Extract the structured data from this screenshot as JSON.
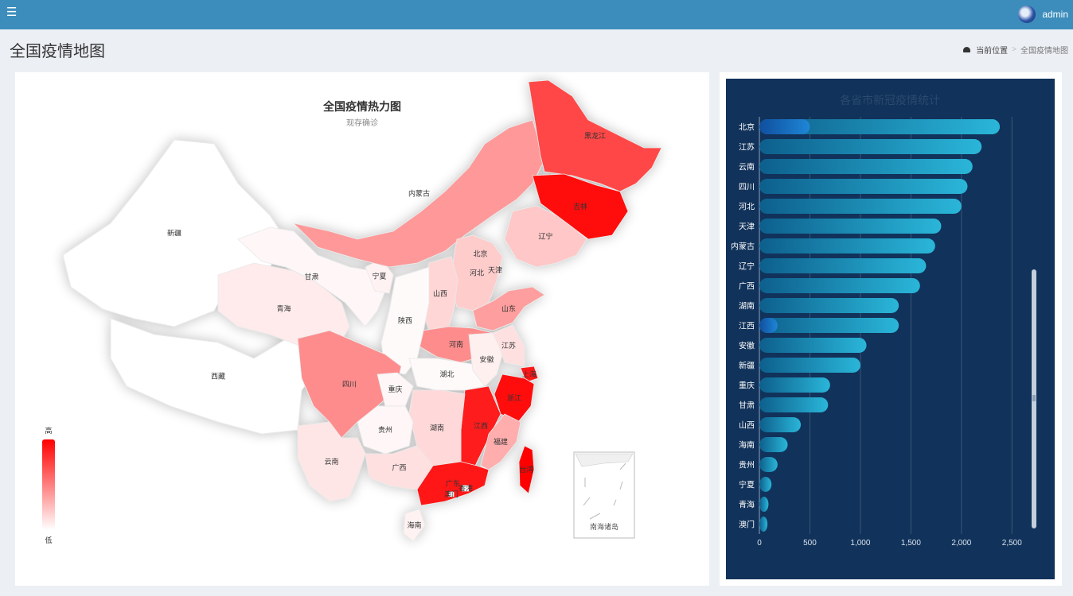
{
  "header": {
    "menu_icon": "hamburger-icon",
    "user_name": "admin",
    "avatar_icon": "avatar-icon"
  },
  "page": {
    "title": "全国疫情地图",
    "breadcrumb": {
      "icon": "dashboard-icon",
      "home": "当前位置",
      "separator": ">",
      "current": "全国疫情地图"
    }
  },
  "map": {
    "title": "全国疫情热力图",
    "subtitle": "现存确诊",
    "legend_high": "高",
    "legend_low": "低",
    "inset_label": "南海诸岛",
    "colors": {
      "high": "#ff0000",
      "low": "#ffffff"
    },
    "regions": [
      {
        "name": "新疆",
        "level": 0.0
      },
      {
        "name": "西藏",
        "level": 0.0
      },
      {
        "name": "青海",
        "level": 0.08
      },
      {
        "name": "甘肃",
        "level": 0.03
      },
      {
        "name": "宁夏",
        "level": 0.05
      },
      {
        "name": "内蒙古",
        "level": 0.4
      },
      {
        "name": "黑龙江",
        "level": 0.72
      },
      {
        "name": "吉林",
        "level": 0.95
      },
      {
        "name": "辽宁",
        "level": 0.22
      },
      {
        "name": "北京",
        "level": 0.98
      },
      {
        "name": "天津",
        "level": 0.1
      },
      {
        "name": "河北",
        "level": 0.2
      },
      {
        "name": "山西",
        "level": 0.16
      },
      {
        "name": "山东",
        "level": 0.38
      },
      {
        "name": "河南",
        "level": 0.45
      },
      {
        "name": "陕西",
        "level": 0.02
      },
      {
        "name": "四川",
        "level": 0.45
      },
      {
        "name": "重庆",
        "level": 0.03
      },
      {
        "name": "湖北",
        "level": 0.02
      },
      {
        "name": "安徽",
        "level": 0.06
      },
      {
        "name": "江苏",
        "level": 0.12
      },
      {
        "name": "上海",
        "level": 0.9
      },
      {
        "name": "浙江",
        "level": 0.97
      },
      {
        "name": "江西",
        "level": 0.88
      },
      {
        "name": "湖南",
        "level": 0.15
      },
      {
        "name": "贵州",
        "level": 0.03
      },
      {
        "name": "云南",
        "level": 0.1
      },
      {
        "name": "广西",
        "level": 0.12
      },
      {
        "name": "广东",
        "level": 0.92
      },
      {
        "name": "福建",
        "level": 0.32
      },
      {
        "name": "台湾",
        "level": 0.98
      },
      {
        "name": "海南",
        "level": 0.05
      },
      {
        "name": "香港",
        "level": 0.0
      },
      {
        "name": "澳门",
        "level": 0.0
      }
    ]
  },
  "chart_data": {
    "type": "bar",
    "orientation": "horizontal",
    "title": "各省市新冠疫情统计",
    "categories": [
      "北京",
      "江苏",
      "云南",
      "四川",
      "河北",
      "天津",
      "内蒙古",
      "辽宁",
      "广西",
      "湖南",
      "江西",
      "安徽",
      "新疆",
      "重庆",
      "甘肃",
      "山西",
      "海南",
      "贵州",
      "宁夏",
      "青海",
      "澳门"
    ],
    "values": [
      2380,
      2200,
      2110,
      2060,
      2000,
      1800,
      1740,
      1650,
      1590,
      1380,
      1380,
      1060,
      1000,
      700,
      680,
      410,
      280,
      180,
      120,
      90,
      80
    ],
    "xlim": [
      0,
      2600
    ],
    "ticks": [
      "0",
      "500",
      "1,000",
      "1,500",
      "2,000",
      "2,500"
    ],
    "tick_values": [
      0,
      500,
      1000,
      1500,
      2000,
      2500
    ],
    "colors": {
      "bar_start": "#0d5f8c",
      "bar_end": "#2ab6d9",
      "background": "#11325a"
    }
  }
}
